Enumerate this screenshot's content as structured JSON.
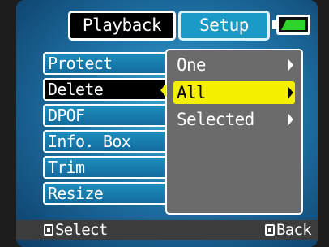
{
  "header": {
    "tabs": [
      {
        "label": "Playback",
        "active": true
      },
      {
        "label": "Setup",
        "active": false
      }
    ],
    "battery_icon": "battery-full-icon"
  },
  "menu": {
    "items": [
      {
        "label": "Protect",
        "selected": false
      },
      {
        "label": "Delete",
        "selected": true
      },
      {
        "label": "DPOF",
        "selected": false
      },
      {
        "label": "Info. Box",
        "selected": false
      },
      {
        "label": "Trim",
        "selected": false
      },
      {
        "label": "Resize",
        "selected": false
      }
    ]
  },
  "submenu": {
    "items": [
      {
        "label": "One",
        "highlighted": false
      },
      {
        "label": "All",
        "highlighted": true
      },
      {
        "label": "Selected",
        "highlighted": false
      }
    ]
  },
  "footer": {
    "select_label": "Select",
    "back_label": "Back"
  },
  "colors": {
    "highlight": "#f5f000",
    "menu_bg": "#1d8fbe",
    "submenu_bg": "#6b6b6b",
    "battery": "#2fd42a"
  }
}
